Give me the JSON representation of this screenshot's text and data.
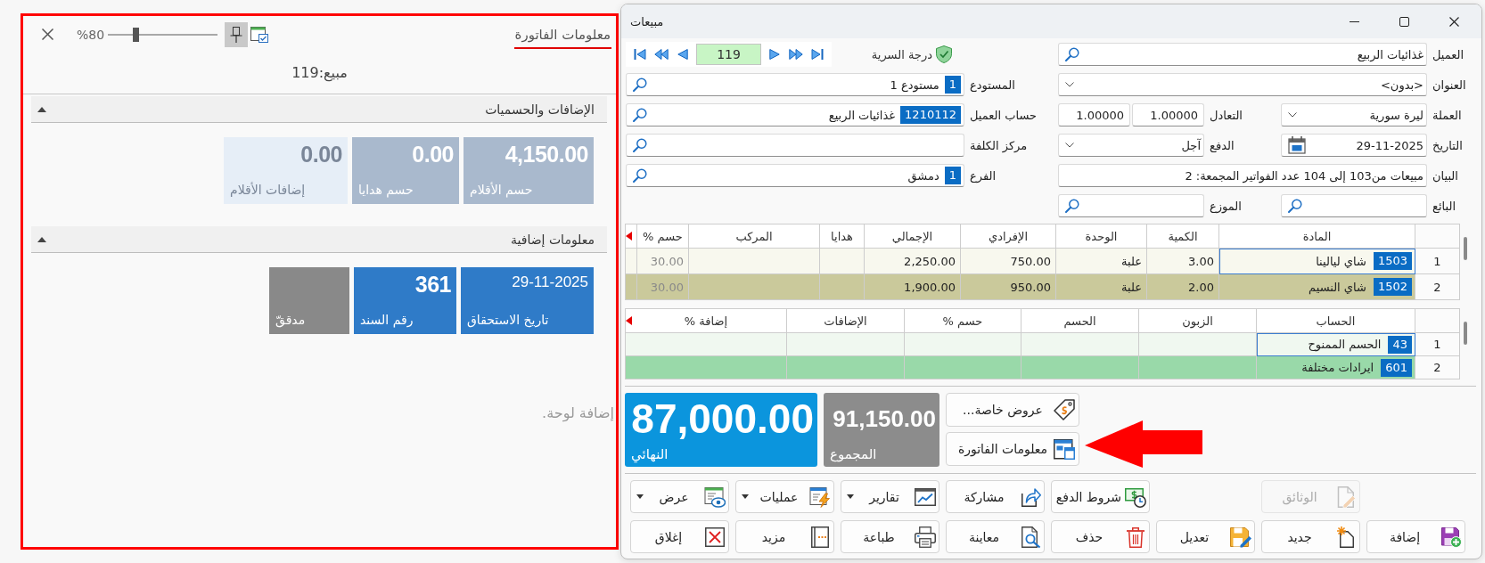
{
  "info_panel": {
    "tabs": [
      {
        "label": "معلومات الفاتورة",
        "selected": true
      }
    ],
    "zoom": {
      "reading": "%80",
      "level": 0.24
    },
    "pinned": true,
    "heading": "مبيع:119",
    "sections": [
      {
        "title": "الإضافات والحسميات",
        "expanded": true,
        "tiles": [
          {
            "kind": "number",
            "value": "4,150.00",
            "label": "حسم الأقلام",
            "color": "#a9b9cd"
          },
          {
            "kind": "number",
            "value": "0.00",
            "label": "حسم هدايا",
            "color": "#a9b9cd"
          },
          {
            "kind": "number",
            "value": "0.00",
            "label": "إضافات الأقلام",
            "color": "#e6eef7"
          }
        ]
      },
      {
        "title": "معلومات إضافية",
        "expanded": true,
        "tiles": [
          {
            "kind": "date",
            "value": "29-11-2025",
            "label": "تاريخ الاستحقاق",
            "color": "#2f7bc8"
          },
          {
            "kind": "number",
            "value": "361",
            "label": "رقم السند",
            "color": "#2f7bc8"
          },
          {
            "kind": "status",
            "label": "مدققّ",
            "color": "#898989"
          }
        ]
      }
    ],
    "hint": "إضافة لوحة."
  },
  "window": {
    "title": "مبيعات"
  },
  "form": {
    "navigator": {
      "record": "119"
    },
    "confidentiality": "درجة السرية",
    "fields": [
      {
        "kind": "lookup",
        "label": "العميل",
        "value": "غذائيات الربيع"
      },
      {
        "kind": "dropdown",
        "label": "العنوان",
        "value": "<بدون>"
      },
      {
        "kind": "lookup",
        "label": "المستودع",
        "code": "1",
        "value": "مستودع 1"
      },
      {
        "kind": "dropdown",
        "label": "العملة",
        "value": "ليرة سورية"
      },
      {
        "kind": "pair",
        "label": "التعادل",
        "values": [
          "1.00000",
          "1.00000"
        ]
      },
      {
        "kind": "lookup",
        "label": "حساب العميل",
        "code": "1210112",
        "value": "غذائيات الربيع"
      },
      {
        "kind": "date",
        "label": "التاريخ",
        "value": "29-11-2025"
      },
      {
        "kind": "dropdown",
        "label": "الدفع",
        "value": "آجل"
      },
      {
        "kind": "lookup",
        "label": "مركز الكلفة"
      },
      {
        "kind": "text",
        "label": "البيان",
        "value": "مبيعات من103 إلى 104 عدد الفواتير المجمعة: 2"
      },
      {
        "kind": "lookup",
        "label": "الفرع",
        "code": "1",
        "value": "دمشق"
      },
      {
        "kind": "lookup",
        "label": "البائع"
      },
      {
        "kind": "lookup",
        "label": "الموزع"
      }
    ]
  },
  "items_table": {
    "columns": [
      "المادة",
      "الكمية",
      "الوحدة",
      "الإفرادي",
      "الإجمالي",
      "هدايا",
      "المركب",
      "حسم %"
    ],
    "rows": [
      {
        "number": "1",
        "code": "1503",
        "item": "شاي ليالينا",
        "quantity": "3.00",
        "unit": "علبة",
        "unit_price": "750.00",
        "total": "2,250.00",
        "discount": "30.00",
        "selected": false,
        "focused": true
      },
      {
        "number": "2",
        "code": "1502",
        "item": "شاي النسيم",
        "quantity": "2.00",
        "unit": "علبة",
        "unit_price": "950.00",
        "total": "1,900.00",
        "discount": "30.00",
        "selected": true,
        "focused": false
      }
    ]
  },
  "adjustments_table": {
    "columns": [
      "الحساب",
      "الزبون",
      "الحسم",
      "حسم %",
      "الإضافات",
      "إضافة %"
    ],
    "rows": [
      {
        "number": "1",
        "code": "43",
        "item": "الحسم الممنوح",
        "selected": false,
        "focused": true
      },
      {
        "number": "2",
        "code": "601",
        "item": "ايرادات مختلفة",
        "selected": true,
        "focused": false
      }
    ]
  },
  "panel_buttons": [
    {
      "label": "عروض خاصة..."
    },
    {
      "label": "معلومات الفاتورة"
    }
  ],
  "totals": [
    {
      "kind": "sum",
      "label": "المجموع",
      "value": "91,150.00",
      "color": "#8c8c8c"
    },
    {
      "kind": "final",
      "label": "النهائي",
      "value": "87,000.00",
      "color": "#0b95dd"
    }
  ],
  "action_buttons": [
    [
      {
        "label": "الوثائق",
        "kind": "plain",
        "disabled": true
      },
      {
        "label": "شروط الدفع",
        "kind": "plain",
        "disabled": false
      },
      {
        "label": "مشاركة",
        "kind": "plain",
        "disabled": false
      },
      {
        "label": "تقارير",
        "kind": "dropdown",
        "disabled": false
      },
      {
        "label": "عمليات",
        "kind": "dropdown",
        "disabled": false
      },
      {
        "label": "عرض",
        "kind": "dropdown",
        "disabled": false
      }
    ],
    [
      {
        "label": "إضافة",
        "kind": "plain",
        "disabled": false
      },
      {
        "label": "جديد",
        "kind": "plain",
        "disabled": false
      },
      {
        "label": "تعديل",
        "kind": "plain",
        "disabled": false
      },
      {
        "label": "حذف",
        "kind": "plain",
        "disabled": false
      },
      {
        "label": "معاينة",
        "kind": "plain",
        "disabled": false
      },
      {
        "label": "طباعة",
        "kind": "plain",
        "disabled": false
      },
      {
        "label": "مزيد",
        "kind": "plain",
        "disabled": false
      },
      {
        "label": "إغلاق",
        "kind": "plain",
        "disabled": false
      }
    ]
  ]
}
